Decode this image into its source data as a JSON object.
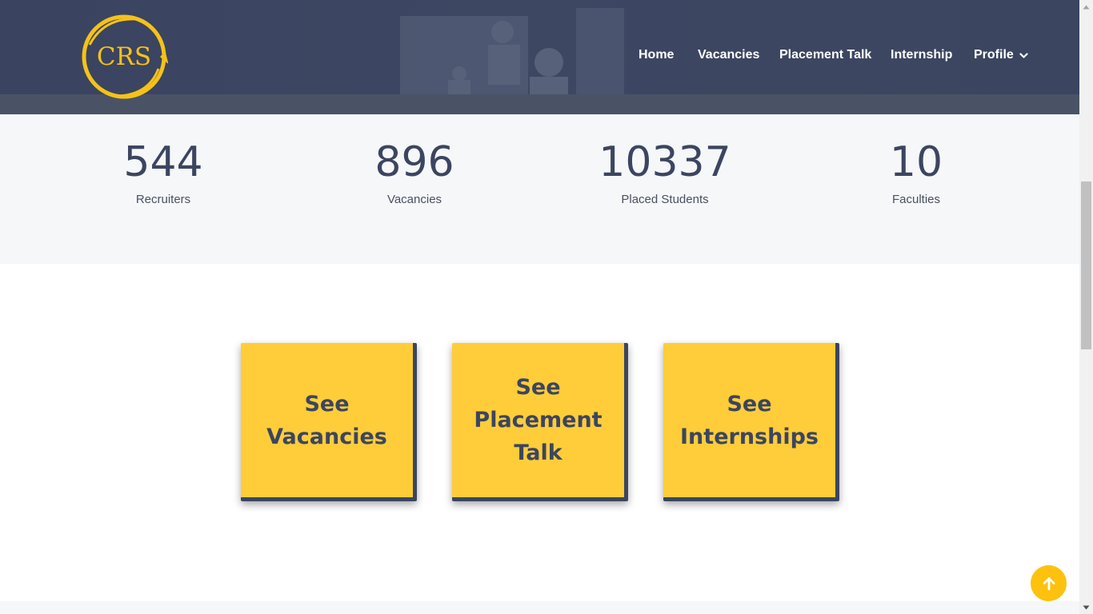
{
  "brand": {
    "logo_text": "CRS",
    "accent": "#f5c218",
    "dark": "#3c4560"
  },
  "nav": {
    "items": [
      {
        "label": "Home"
      },
      {
        "label": "Vacancies"
      },
      {
        "label": "Placement Talk"
      },
      {
        "label": "Internship"
      },
      {
        "label": "Profile"
      }
    ],
    "profile_icon": "chevron-down-icon"
  },
  "stats": [
    {
      "value": "544",
      "label": "Recruiters"
    },
    {
      "value": "896",
      "label": "Vacancies"
    },
    {
      "value": "10337",
      "label": "Placed Students"
    },
    {
      "value": "10",
      "label": "Faculties"
    }
  ],
  "cards": [
    {
      "label": "See Vacancies"
    },
    {
      "label": "See Placement Talk"
    },
    {
      "label": "See Internships"
    }
  ],
  "back_to_top_icon": "arrow-up-icon"
}
